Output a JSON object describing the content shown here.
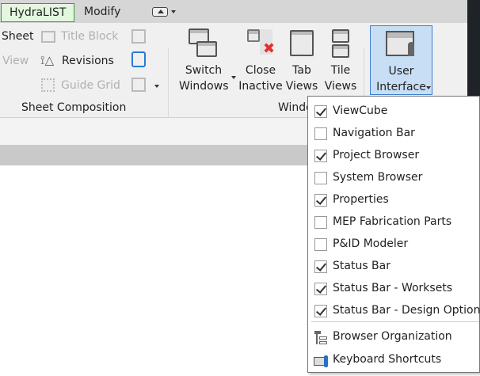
{
  "tabs": [
    {
      "label": "HydraLIST",
      "active": true
    },
    {
      "label": "Modify"
    }
  ],
  "ribbon": {
    "sheet_composition": {
      "title": "Sheet Composition",
      "items": [
        {
          "label": "Sheet",
          "enabled": true
        },
        {
          "label": "Title  Block",
          "enabled": false
        },
        {
          "label": "View",
          "enabled": false
        },
        {
          "label": "Revisions",
          "enabled": true
        },
        {
          "label": "Guide  Grid",
          "enabled": false
        }
      ]
    },
    "windows": {
      "title": "Windows",
      "title_visible": "Windo",
      "buttons": [
        {
          "line1": "Switch",
          "line2": "Windows",
          "icon": "switch-windows-icon",
          "dropdown": true
        },
        {
          "line1": "Close",
          "line2": "Inactive",
          "icon": "close-inactive-icon"
        },
        {
          "line1": "Tab",
          "line2": "Views",
          "icon": "tab-views-icon"
        },
        {
          "line1": "Tile",
          "line2": "Views",
          "icon": "tile-views-icon"
        }
      ]
    },
    "user_interface": {
      "line1": "User",
      "line2": "Interface",
      "icon": "user-interface-icon",
      "dropdown": true,
      "active": true
    }
  },
  "menu": {
    "checks": [
      {
        "label": "ViewCube",
        "checked": true
      },
      {
        "label": "Navigation Bar",
        "checked": false
      },
      {
        "label": "Project Browser",
        "checked": true
      },
      {
        "label": "System Browser",
        "checked": false
      },
      {
        "label": "Properties",
        "checked": true
      },
      {
        "label": "MEP Fabrication Parts",
        "checked": false
      },
      {
        "label": "P&ID Modeler",
        "checked": false
      },
      {
        "label": "Status Bar",
        "checked": true
      },
      {
        "label": "Status Bar - Worksets",
        "checked": true
      },
      {
        "label": "Status Bar - Design Options",
        "checked": true
      }
    ],
    "actions": [
      {
        "label": "Browser Organization",
        "icon": "browser-organization-icon"
      },
      {
        "label": "Keyboard Shortcuts",
        "icon": "keyboard-shortcuts-icon"
      }
    ]
  },
  "colors": {
    "accent": "#3d7fd0",
    "active_button": "#c7def4",
    "active_tab": "#e3f7df"
  }
}
